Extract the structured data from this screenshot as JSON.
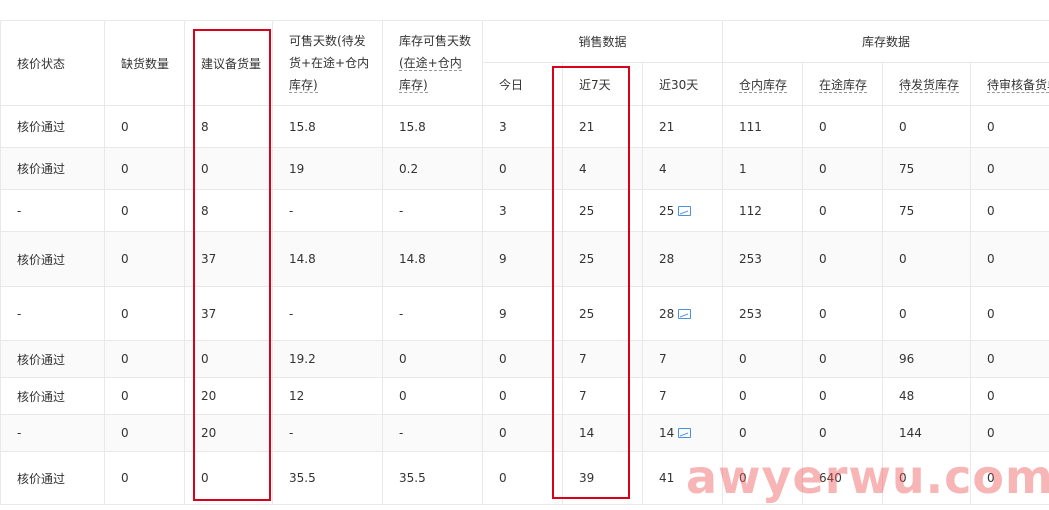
{
  "headers": {
    "price_status": "核价状态",
    "shortage_qty": "缺货数量",
    "suggested_stock": "建议备货量",
    "sellable_days_line1": "可售天数(待发",
    "sellable_days_line2": "货+在途+仓内",
    "sellable_days_line3": "库存)",
    "inventory_days_line1": "库存可售天数",
    "inventory_days_line2": "(在途+仓内",
    "inventory_days_line3": "库存)",
    "sales_group": "销售数据",
    "today": "今日",
    "last7": "近7天",
    "last30": "近30天",
    "inventory_group": "库存数据",
    "warehouse_stock": "仓内库存",
    "in_transit": "在途库存",
    "pending_ship": "待发货库存",
    "pending_review": "待审核备货单"
  },
  "rows": [
    {
      "status": "核价通过",
      "shortage": "0",
      "suggested": "8",
      "sellable": "15.8",
      "inv_days": "15.8",
      "today": "3",
      "d7": "21",
      "d30": "21",
      "chart": false,
      "warehouse": "111",
      "transit": "0",
      "pending_ship": "0",
      "pending_review": "0"
    },
    {
      "status": "核价通过",
      "shortage": "0",
      "suggested": "0",
      "sellable": "19",
      "inv_days": "0.2",
      "today": "0",
      "d7": "4",
      "d30": "4",
      "chart": false,
      "warehouse": "1",
      "transit": "0",
      "pending_ship": "75",
      "pending_review": "0"
    },
    {
      "status": "-",
      "shortage": "0",
      "suggested": "8",
      "sellable": "-",
      "inv_days": "-",
      "today": "3",
      "d7": "25",
      "d30": "25",
      "chart": true,
      "warehouse": "112",
      "transit": "0",
      "pending_ship": "75",
      "pending_review": "0"
    },
    {
      "status": "核价通过",
      "shortage": "0",
      "suggested": "37",
      "sellable": "14.8",
      "inv_days": "14.8",
      "today": "9",
      "d7": "25",
      "d30": "28",
      "chart": false,
      "warehouse": "253",
      "transit": "0",
      "pending_ship": "0",
      "pending_review": "0"
    },
    {
      "status": "-",
      "shortage": "0",
      "suggested": "37",
      "sellable": "-",
      "inv_days": "-",
      "today": "9",
      "d7": "25",
      "d30": "28",
      "chart": true,
      "warehouse": "253",
      "transit": "0",
      "pending_ship": "0",
      "pending_review": "0"
    },
    {
      "status": "核价通过",
      "shortage": "0",
      "suggested": "0",
      "sellable": "19.2",
      "inv_days": "0",
      "today": "0",
      "d7": "7",
      "d30": "7",
      "chart": false,
      "warehouse": "0",
      "transit": "0",
      "pending_ship": "96",
      "pending_review": "0"
    },
    {
      "status": "核价通过",
      "shortage": "0",
      "suggested": "20",
      "sellable": "12",
      "inv_days": "0",
      "today": "0",
      "d7": "7",
      "d30": "7",
      "chart": false,
      "warehouse": "0",
      "transit": "0",
      "pending_ship": "48",
      "pending_review": "0"
    },
    {
      "status": "-",
      "shortage": "0",
      "suggested": "20",
      "sellable": "-",
      "inv_days": "-",
      "today": "0",
      "d7": "14",
      "d30": "14",
      "chart": true,
      "warehouse": "0",
      "transit": "0",
      "pending_ship": "144",
      "pending_review": "0"
    },
    {
      "status": "核价通过",
      "shortage": "0",
      "suggested": "0",
      "sellable": "35.5",
      "inv_days": "35.5",
      "today": "0",
      "d7": "39",
      "d30": "41",
      "chart": false,
      "warehouse": "0",
      "transit": "640",
      "pending_ship": "0",
      "pending_review": "0"
    }
  ],
  "watermark": "awyerwu.com",
  "colors": {
    "highlight_box": "#d9001b",
    "chart_icon": "#4a90e2",
    "watermark": "#f05a5a"
  }
}
